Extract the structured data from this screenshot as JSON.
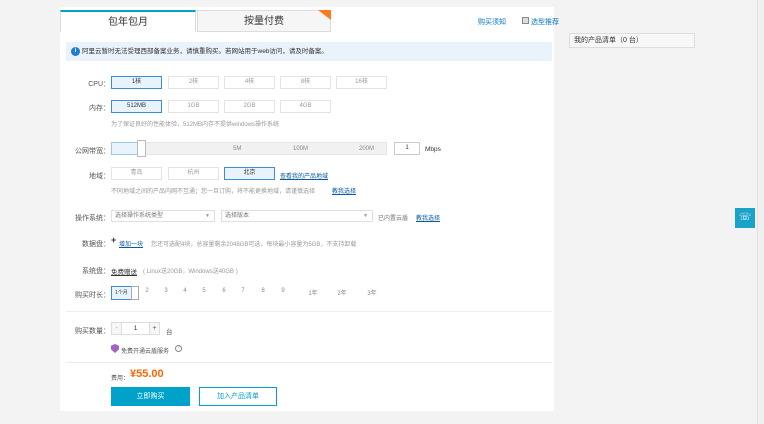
{
  "tabs": {
    "monthly": "包年包月",
    "payg": "按量付费"
  },
  "top_links": {
    "notice": "购买须知",
    "guide": "选型推荐"
  },
  "notice": "阿里云暂时无法受理西部备案业务，请慎重购买。若网站用于web访问，请及时备案。",
  "cpu": {
    "label": "CPU：",
    "options": [
      "1核",
      "2核",
      "4核",
      "8核",
      "16核"
    ]
  },
  "memory": {
    "label": "内存：",
    "options": [
      "512MB",
      "1GB",
      "2GB",
      "4GB"
    ],
    "hint": "为了保证良好的性能体验，512MB内存不提供windows操作系统"
  },
  "bandwidth": {
    "label": "公网带宽：",
    "marks": [
      "5M",
      "100M",
      "200M"
    ],
    "value": "1",
    "unit": "Mbps"
  },
  "region": {
    "label": "地域：",
    "options": [
      "青岛",
      "杭州",
      "北京"
    ],
    "link": "查看我的产品地域",
    "hint": "不同地域之间的产品内网不互通；您一旦订购，将不能更换地域，请谨慎选择",
    "hint_link": "教我选择"
  },
  "os": {
    "label": "操作系统：",
    "type_placeholder": "选择操作系统类型",
    "version_placeholder": "选择版本",
    "security": "已内置云盾",
    "link": "教我选择"
  },
  "datadisk": {
    "label": "数据盘：",
    "add": "增加一块",
    "hint": "您还可选配4块，总容量剩余2048GB可选，每块最小容量为5GB，不支持卸载"
  },
  "systemdisk": {
    "label": "系统盘：",
    "value": "免费赠送",
    "hint": "( Linux送20GB，Windows送40GB )"
  },
  "duration": {
    "label": "购买时长：",
    "selected": "1个月",
    "options": [
      "2",
      "3",
      "4",
      "5",
      "6",
      "7",
      "8",
      "9",
      "1年",
      "2年",
      "3年"
    ]
  },
  "quantity": {
    "label": "购买数量：",
    "minus": "-",
    "value": "1",
    "plus": "+",
    "unit": "台"
  },
  "free_service": "免费开通云盾服务",
  "price": {
    "label": "费用：",
    "value": "¥55.00"
  },
  "buttons": {
    "buy": "立即购买",
    "add": "加入产品清单"
  },
  "cart": "我的产品清单（0 台）",
  "colors": {
    "accent": "#00a2ca",
    "price": "#ff6600"
  }
}
